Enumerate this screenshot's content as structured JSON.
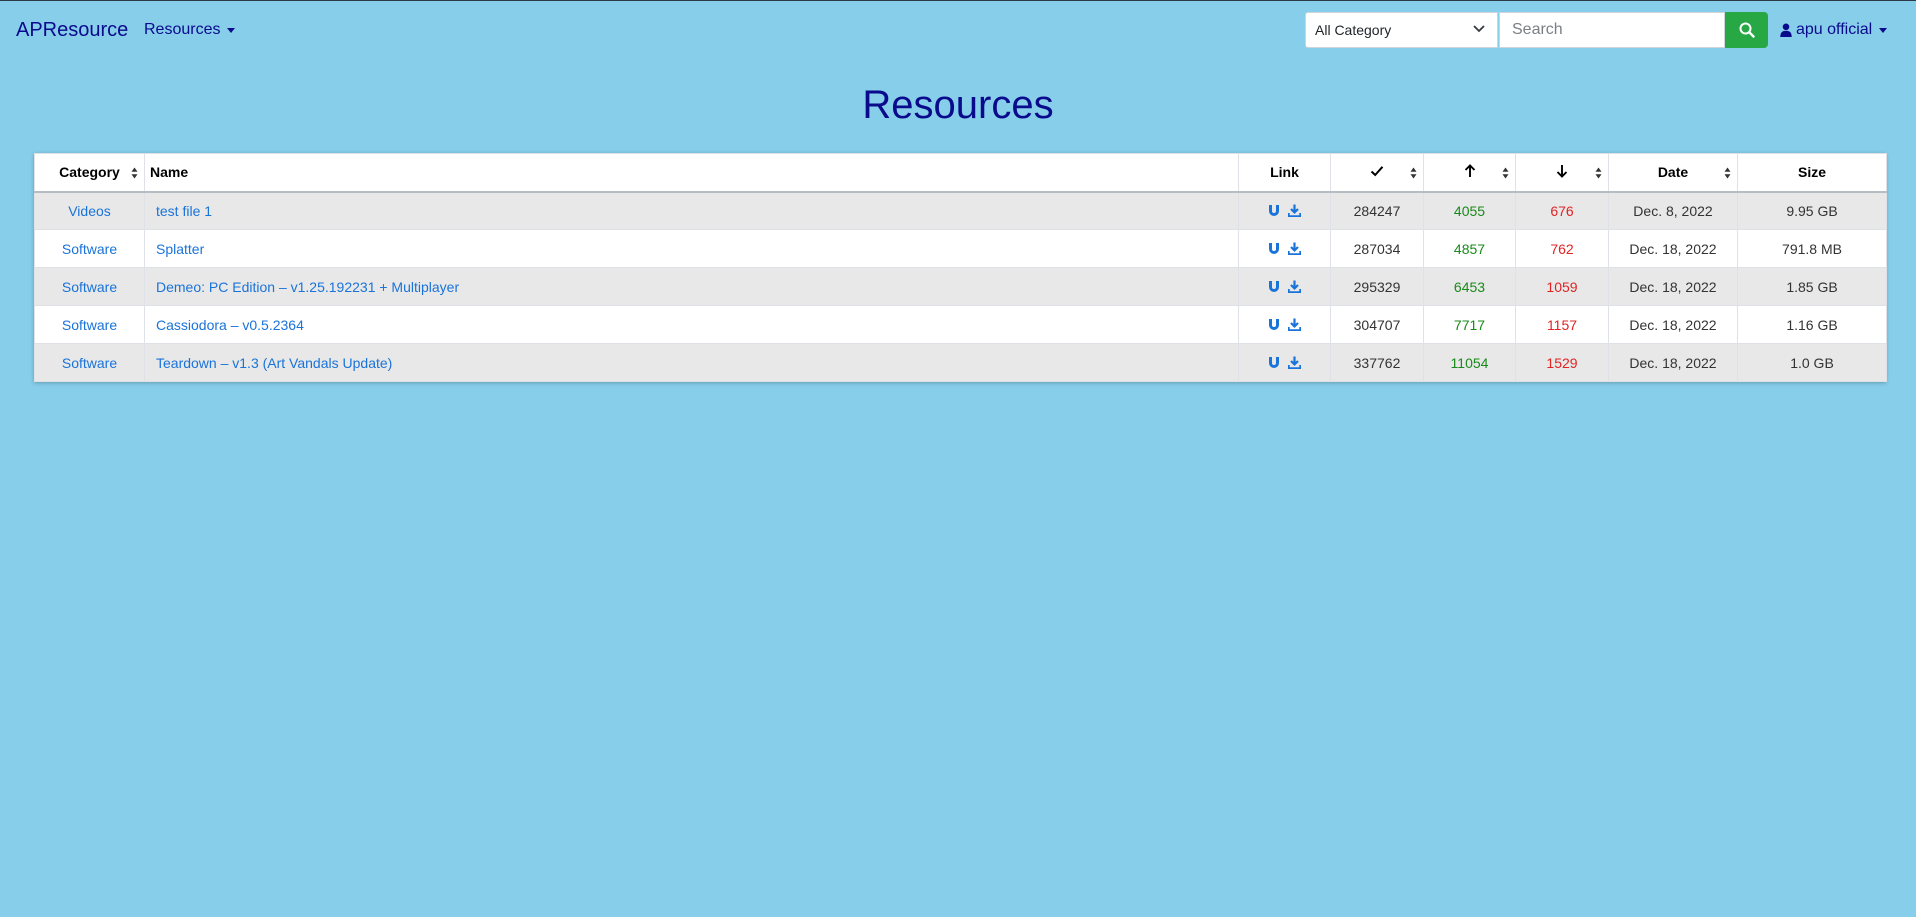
{
  "navbar": {
    "brand": "APResource",
    "resources_menu": "Resources",
    "category_select": "All Category",
    "search_placeholder": "Search",
    "user": "apu official"
  },
  "page": {
    "title": "Resources"
  },
  "table": {
    "headers": {
      "category": "Category",
      "name": "Name",
      "link": "Link",
      "date": "Date",
      "size": "Size"
    },
    "header_icons": [
      "check-icon",
      "arrow-up-icon",
      "arrow-down-icon"
    ],
    "rows": [
      {
        "category": "Videos",
        "name": "test file 1",
        "completed": "284247",
        "seeders": "4055",
        "leechers": "676",
        "date": "Dec. 8, 2022",
        "size": "9.95 GB"
      },
      {
        "category": "Software",
        "name": "Splatter",
        "completed": "287034",
        "seeders": "4857",
        "leechers": "762",
        "date": "Dec. 18, 2022",
        "size": "791.8 MB"
      },
      {
        "category": "Software",
        "name": "Demeo: PC Edition – v1.25.192231 + Multiplayer",
        "completed": "295329",
        "seeders": "6453",
        "leechers": "1059",
        "date": "Dec. 18, 2022",
        "size": "1.85 GB"
      },
      {
        "category": "Software",
        "name": "Cassiodora – v0.5.2364",
        "completed": "304707",
        "seeders": "7717",
        "leechers": "1157",
        "date": "Dec. 18, 2022",
        "size": "1.16 GB"
      },
      {
        "category": "Software",
        "name": "Teardown – v1.3 (Art Vandals Update)",
        "completed": "337762",
        "seeders": "11054",
        "leechers": "1529",
        "date": "Dec. 18, 2022",
        "size": "1.0 GB"
      }
    ]
  },
  "colors": {
    "background": "#87ceeb",
    "brand": "#0a0a8c",
    "link": "#1a73d9",
    "seeders": "#1a8a1a",
    "leechers": "#e02424",
    "search_button": "#28a745"
  }
}
